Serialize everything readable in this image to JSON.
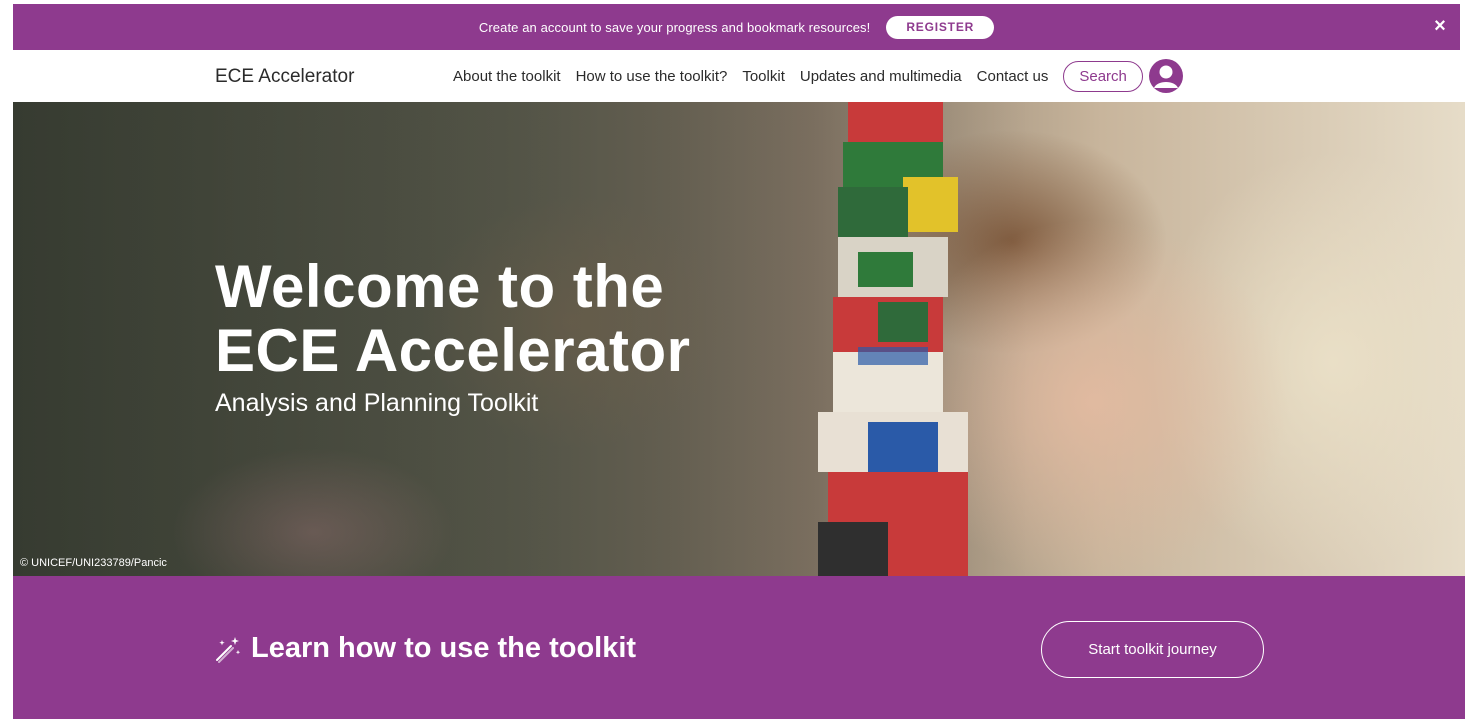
{
  "banner": {
    "text": "Create an account to save your progress and bookmark resources!",
    "register_label": "REGISTER",
    "close_glyph": "×"
  },
  "nav": {
    "brand": "ECE Accelerator",
    "links": [
      "About the toolkit",
      "How to use the toolkit?",
      "Toolkit",
      "Updates and multimedia",
      "Contact us"
    ],
    "search_label": "Search",
    "avatar_icon": "user-circle-icon"
  },
  "hero": {
    "title_line1": "Welcome to the",
    "title_line2": "ECE Accelerator",
    "subtitle": "Analysis and Planning Toolkit",
    "credit": "© UNICEF/UNI233789/Pancic"
  },
  "cta": {
    "icon": "magic-wand-icon",
    "title": "Learn how to use the toolkit",
    "button_label": "Start toolkit journey"
  },
  "colors": {
    "brand_purple": "#8e3a8e",
    "white": "#ffffff",
    "text_dark": "#2b2b2b"
  }
}
